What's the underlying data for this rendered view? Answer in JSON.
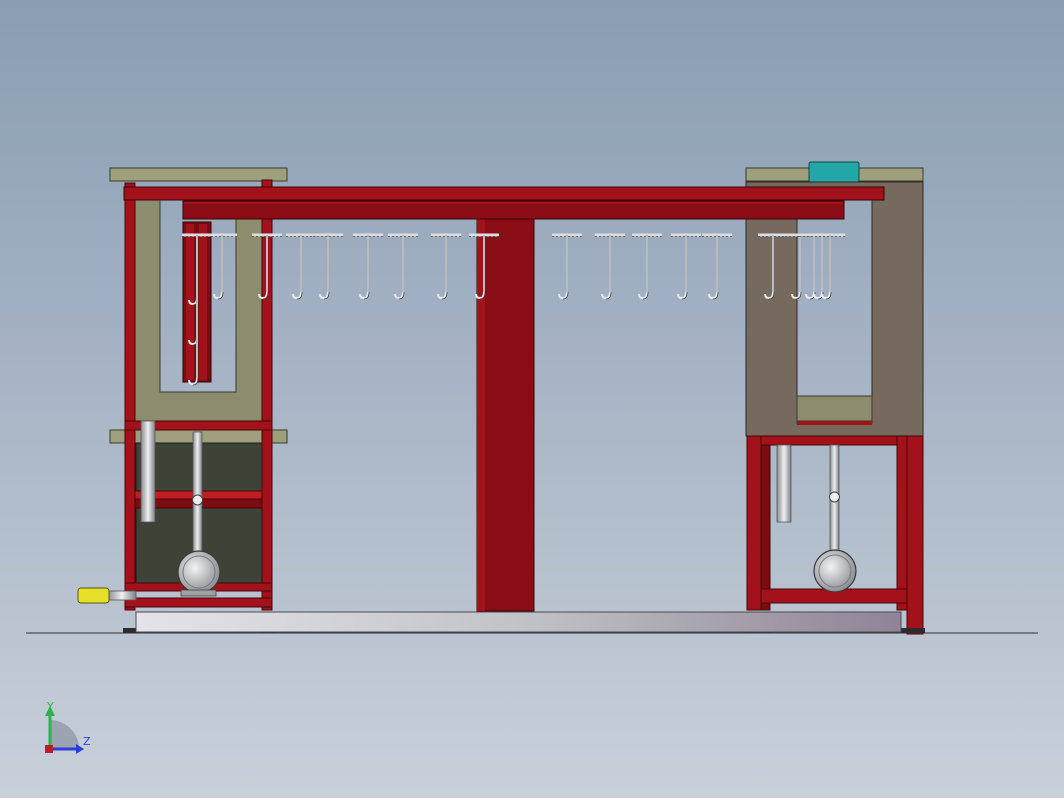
{
  "view": {
    "background_top": "#8a9db3",
    "background_bottom": "#c9d0da"
  },
  "colors": {
    "frame_red": "#a3121b",
    "frame_dark": "#6e0a10",
    "panel_olive": "#8b8d6e",
    "panel_olive_dark": "#5e604a",
    "tank_dark": "#3e4337",
    "tank_gray": "#767064",
    "steel": "#c9ccd0",
    "steel_dark": "#7d8085",
    "accent_teal": "#22a6a6",
    "accent_yellow": "#e7e02b",
    "base_rail": "#cfd0d6"
  },
  "triad": {
    "y_label": "Y",
    "z_label": "Z",
    "y_color": "#2bb24c",
    "z_color": "#2a3fd6"
  },
  "hook_count": 21
}
